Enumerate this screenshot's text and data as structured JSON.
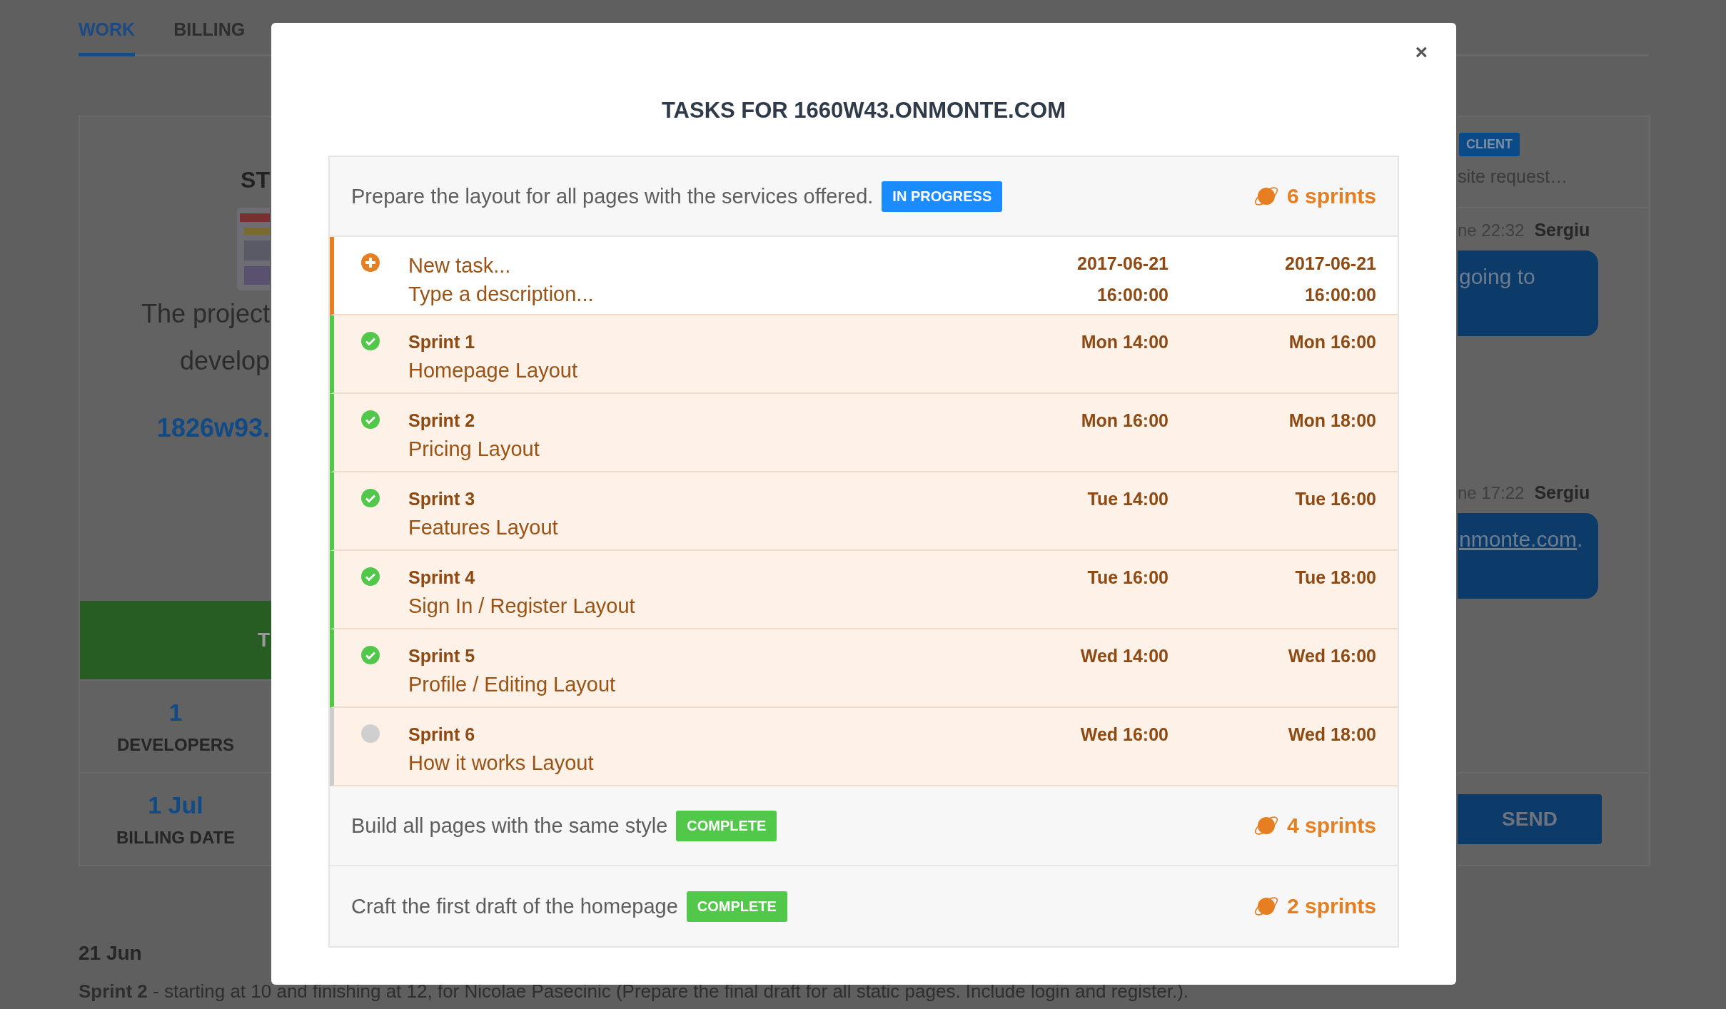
{
  "tabs": [
    {
      "label": "WORK",
      "selected": true
    },
    {
      "label": "BILLING",
      "selected": false
    }
  ],
  "project_card": {
    "title": "ST",
    "description_lines": [
      "The project",
      "develop"
    ],
    "link": "1826w93.",
    "action_bar": "T",
    "stats": [
      {
        "value": "1",
        "label": "DEVELOPERS"
      },
      {
        "value": "1 Jul",
        "label": "BILLING DATE"
      }
    ]
  },
  "chat": {
    "badge": "CLIENT",
    "subject": "site request…",
    "messages": [
      {
        "time": "ne 22:32",
        "author": "Sergiu",
        "text": "going to"
      },
      {
        "time": "ne 17:22",
        "author": "Sergiu",
        "link": "nmonte.com",
        "text": "."
      }
    ],
    "send_button": "SEND"
  },
  "activity": {
    "date": "21 Jun",
    "entry": "**Sprint 2** - starting at 10 and finishing at 12, for Nicolae Pasecinic (Prepare the final draft for all static pages. Include login and register.)."
  },
  "modal": {
    "title": "TASKS FOR 1660W43.ONMONTE.COM",
    "close": "×",
    "tasks": [
      {
        "title": "Prepare the layout for all pages with the services offered.",
        "status": "IN PROGRESS",
        "kind": "in_progress",
        "sprints": "6 sprints",
        "items": [
          {
            "kind": "new",
            "placeholder": "New task...",
            "description_placeholder": "Type a description...",
            "start_date": "2017-06-21",
            "start_time": "16:00:00",
            "end_date": "2017-06-21",
            "end_time": "16:00:00"
          },
          {
            "kind": "sprint",
            "done": true,
            "name": "Sprint 1",
            "description": "Homepage Layout",
            "start": "Mon 14:00",
            "end": "Mon 16:00"
          },
          {
            "kind": "sprint",
            "done": true,
            "name": "Sprint 2",
            "description": "Pricing Layout",
            "start": "Mon 16:00",
            "end": "Mon 18:00"
          },
          {
            "kind": "sprint",
            "done": true,
            "name": "Sprint 3",
            "description": "Features Layout",
            "start": "Tue 14:00",
            "end": "Tue 16:00"
          },
          {
            "kind": "sprint",
            "done": true,
            "name": "Sprint 4",
            "description": "Sign In / Register Layout",
            "start": "Tue 16:00",
            "end": "Tue 18:00"
          },
          {
            "kind": "sprint",
            "done": true,
            "name": "Sprint 5",
            "description": "Profile / Editing Layout",
            "start": "Wed 14:00",
            "end": "Wed 16:00"
          },
          {
            "kind": "sprint",
            "done": false,
            "name": "Sprint 6",
            "description": "How it works Layout",
            "start": "Wed 16:00",
            "end": "Wed 18:00"
          }
        ]
      },
      {
        "title": "Build all pages with the same style",
        "status": "COMPLETE",
        "kind": "complete",
        "sprints": "4 sprints"
      },
      {
        "title": "Craft the first draft of the homepage",
        "status": "COMPLETE",
        "kind": "complete",
        "sprints": "2 sprints"
      }
    ]
  }
}
